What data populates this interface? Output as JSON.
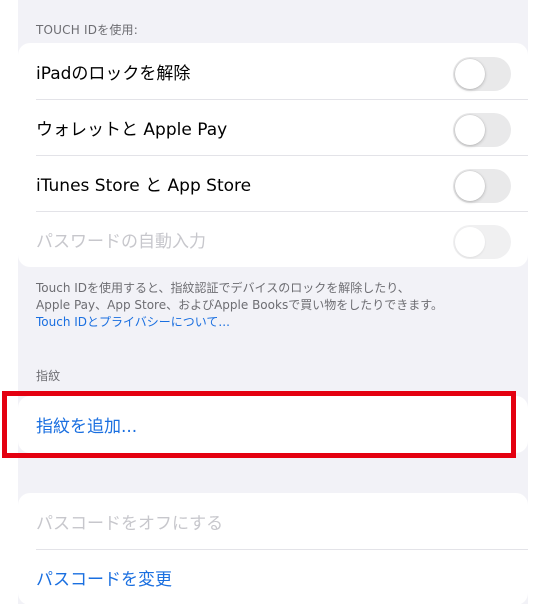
{
  "touch_id_section": {
    "header": "TOUCH IDを使用:",
    "rows": [
      {
        "label": "iPadのロックを解除",
        "toggle": "off",
        "enabled": true
      },
      {
        "label": "ウォレットと Apple Pay",
        "toggle": "off",
        "enabled": true
      },
      {
        "label": "iTunes Store と App Store",
        "toggle": "off",
        "enabled": true
      },
      {
        "label": "パスワードの自動入力",
        "toggle": "off",
        "enabled": false
      }
    ],
    "footer_lines": [
      "Touch IDを使用すると、指紋認証でデバイスのロックを解除したり、",
      "Apple Pay、App Store、およびApple Booksで買い物をしたりできます。"
    ],
    "footer_link": "Touch IDとプライバシーについて..."
  },
  "fingerprint_section": {
    "header": "指紋",
    "add_label": "指紋を追加..."
  },
  "passcode_section": {
    "turn_off_label": "パスコードをオフにする",
    "change_label": "パスコードを変更"
  },
  "colors": {
    "accent": "#1a6fe0",
    "highlight": "#e40010",
    "background": "#f2f2f7"
  }
}
